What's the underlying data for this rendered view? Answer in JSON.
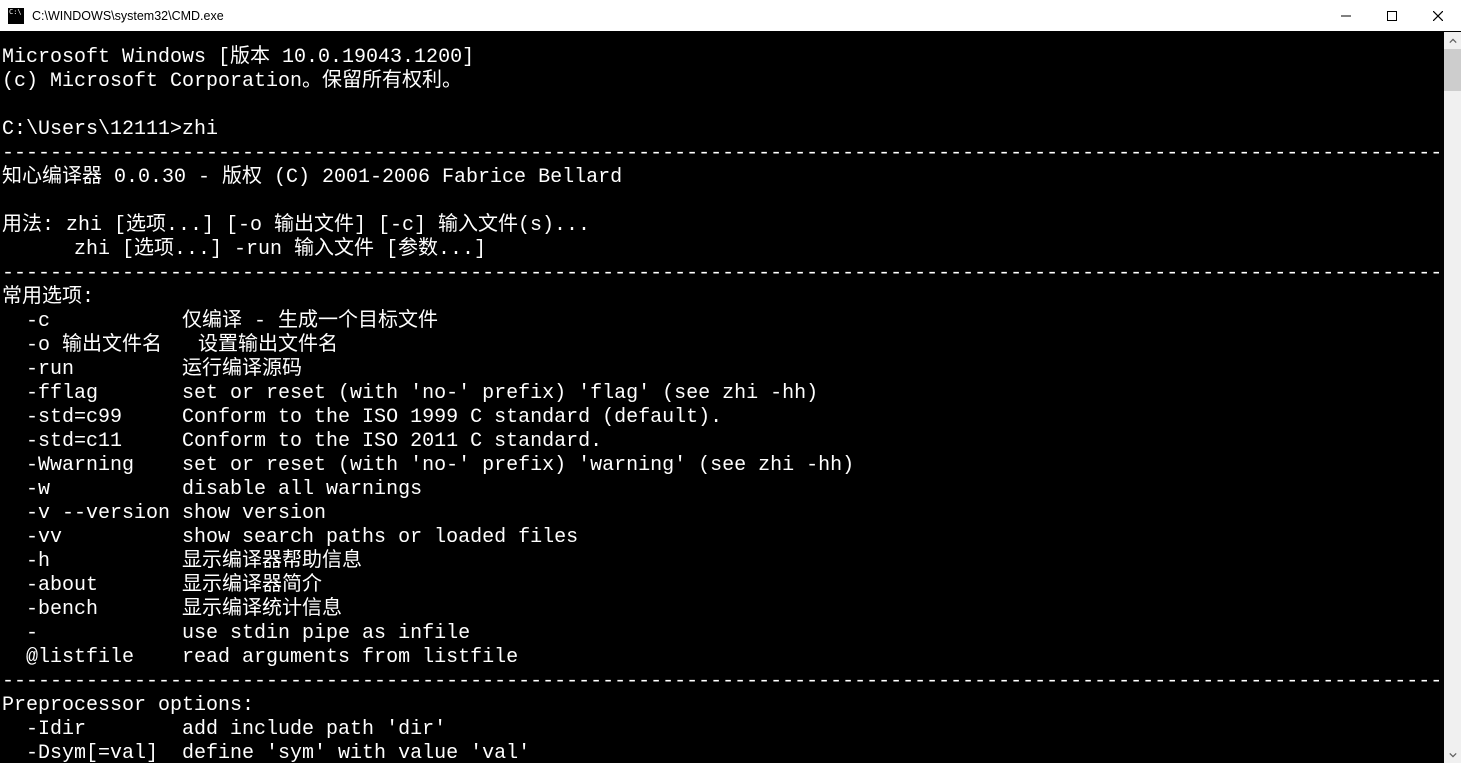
{
  "window": {
    "title": "C:\\WINDOWS\\system32\\CMD.exe"
  },
  "console": {
    "lines": [
      "Microsoft Windows [版本 10.0.19043.1200]",
      "(c) Microsoft Corporation。保留所有权利。",
      "",
      "C:\\Users\\12111>zhi",
      "------------------------------------------------------------------------------------------------------------------------",
      "知心编译器 0.0.30 - 版权 (C) 2001-2006 Fabrice Bellard",
      "",
      "用法: zhi [选项...] [-o 输出文件] [-c] 输入文件(s)...",
      "      zhi [选项...] -run 输入文件 [参数...]",
      "------------------------------------------------------------------------------------------------------------------------",
      "常用选项:",
      "  -c           仅编译 - 生成一个目标文件",
      "  -o 输出文件名   设置输出文件名",
      "  -run         运行编译源码",
      "  -fflag       set or reset (with 'no-' prefix) 'flag' (see zhi -hh)",
      "  -std=c99     Conform to the ISO 1999 C standard (default).",
      "  -std=c11     Conform to the ISO 2011 C standard.",
      "  -Wwarning    set or reset (with 'no-' prefix) 'warning' (see zhi -hh)",
      "  -w           disable all warnings",
      "  -v --version show version",
      "  -vv          show search paths or loaded files",
      "  -h           显示编译器帮助信息",
      "  -about       显示编译器简介",
      "  -bench       显示编译统计信息",
      "  -            use stdin pipe as infile",
      "  @listfile    read arguments from listfile",
      "------------------------------------------------------------------------------------------------------------------------",
      "Preprocessor options:",
      "  -Idir        add include path 'dir'",
      "  -Dsym[=val]  define 'sym' with value 'val'"
    ]
  }
}
